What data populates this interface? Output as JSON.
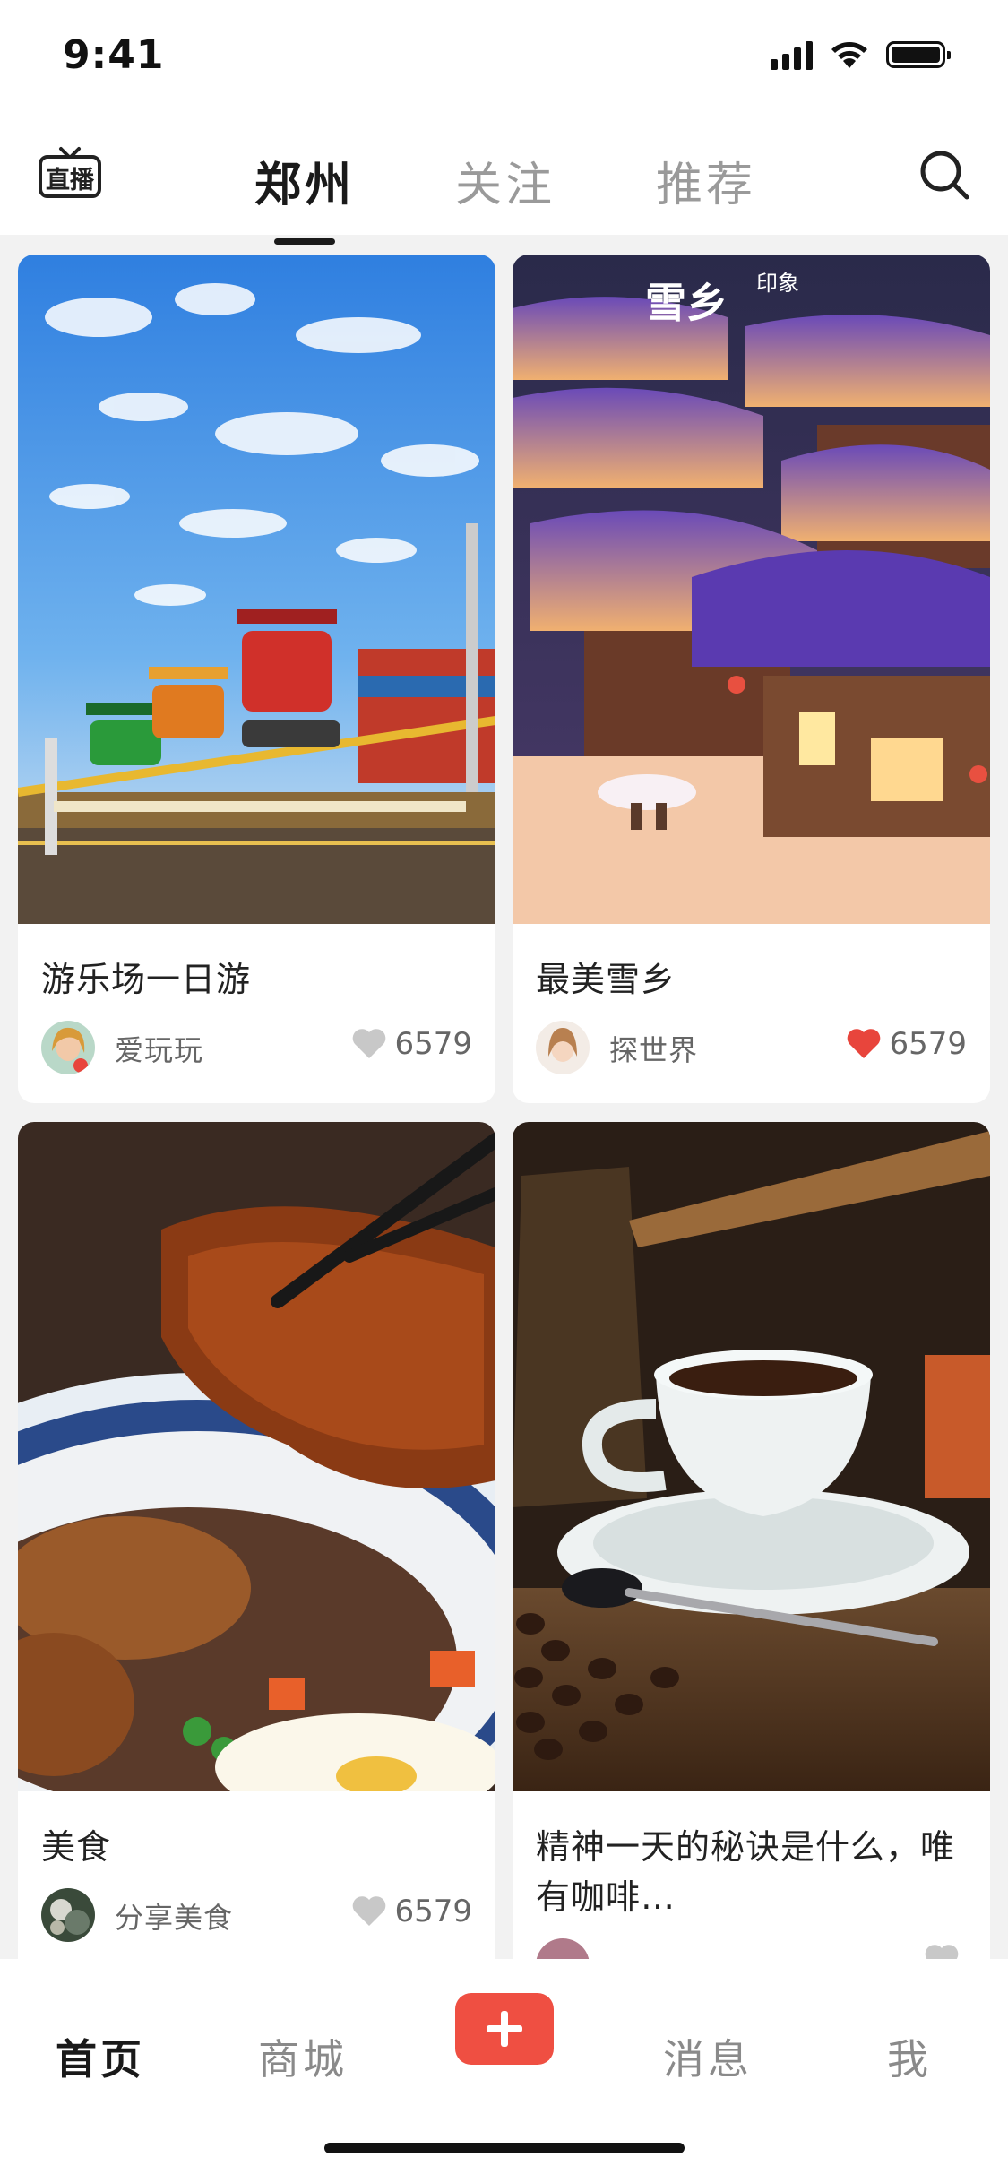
{
  "status_bar": {
    "time": "9:41"
  },
  "top_nav": {
    "live_label": "直播",
    "tabs": [
      {
        "label": "郑州",
        "active": true
      },
      {
        "label": "关注",
        "active": false
      },
      {
        "label": "推荐",
        "active": false
      }
    ]
  },
  "feed": {
    "cards": [
      {
        "title": "游乐场一日游",
        "author": "爱玩玩",
        "likes": "6579",
        "liked": false,
        "image": "amusement-park-ride-photo"
      },
      {
        "title": "最美雪乡",
        "author": "探世界",
        "likes": "6579",
        "liked": true,
        "image": "snow-village-night-photo",
        "image_text": {
          "big": "雪乡",
          "small": "印象"
        }
      },
      {
        "title": "美食",
        "author": "分享美食",
        "likes": "6579",
        "liked": false,
        "image": "steak-with-chopsticks-photo"
      },
      {
        "title": "精神一天的秘诀是什么，唯有咖啡…",
        "author": "",
        "likes": "",
        "liked": false,
        "image": "coffee-cup-photo"
      }
    ]
  },
  "tab_bar": {
    "items": [
      {
        "label": "首页",
        "active": true
      },
      {
        "label": "商城",
        "active": false
      },
      {
        "label": "消息",
        "active": false
      },
      {
        "label": "我",
        "active": false
      }
    ],
    "add_icon": "plus-icon"
  },
  "colors": {
    "accent": "#ef4f42",
    "liked_heart": "#e8453c",
    "unliked_heart": "#c8c8c8"
  }
}
